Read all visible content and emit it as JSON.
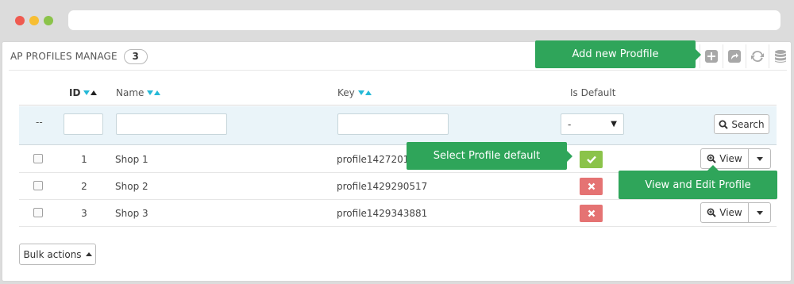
{
  "window": {
    "controls": [
      "close",
      "minimize",
      "maximize"
    ]
  },
  "panel": {
    "title": "AP PROFILES MANAGE",
    "count": "3",
    "toolbar_icons": [
      "plus-square-icon",
      "share-icon",
      "refresh-icon",
      "database-icon"
    ]
  },
  "table": {
    "headers": {
      "id": "ID",
      "name": "Name",
      "key": "Key",
      "is_default": "Is Default"
    },
    "filters": {
      "dash": "--",
      "id_value": "",
      "name_value": "",
      "key_value": "",
      "default_selected": "-",
      "search_label": "Search"
    },
    "rows": [
      {
        "id": "1",
        "name": "Shop 1",
        "key": "profile14272015",
        "is_default": "yes"
      },
      {
        "id": "2",
        "name": "Shop 2",
        "key": "profile1429290517",
        "is_default": "no"
      },
      {
        "id": "3",
        "name": "Shop 3",
        "key": "profile1429343881",
        "is_default": "no"
      }
    ],
    "view_label": "View"
  },
  "bulk_actions_label": "Bulk actions",
  "tooltips": {
    "add_new": "Add new Prodfile",
    "select_default": "Select Profile default",
    "view_edit": "View and Edit Profile"
  },
  "colors": {
    "tooltip_green": "#2fa55a",
    "sort_arrow": "#25b9d7",
    "yes_green": "#8bc34a",
    "no_red": "#e57373",
    "filter_row_bg": "#eaf4f9"
  }
}
